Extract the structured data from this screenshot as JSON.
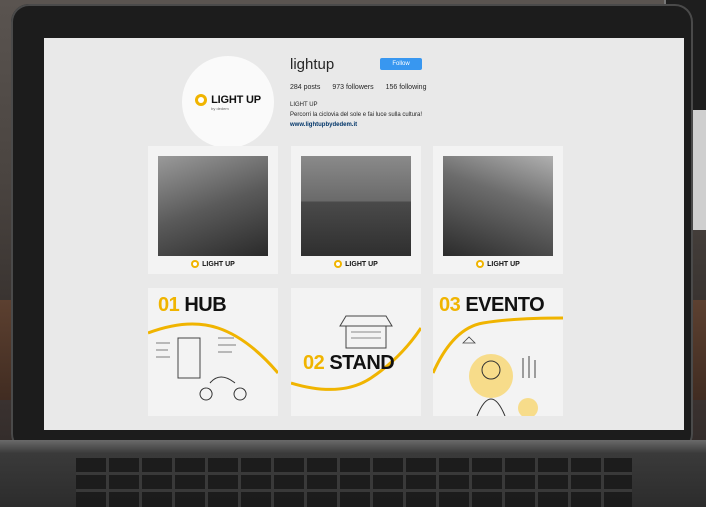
{
  "profile": {
    "username": "lightup",
    "follow_label": "Follow",
    "posts": "284 posts",
    "followers": "973 followers",
    "following": "156 following",
    "bio_name": "LIGHT UP",
    "bio_text": "Percorri la ciclovia del sole e fai luce sulla cultura!",
    "bio_link": "www.lightupbydedem.it",
    "avatar_logo": "LIGHT UP",
    "avatar_sub": "by dedem"
  },
  "posts": [
    {
      "caption_logo": "LIGHT UP"
    },
    {
      "caption_logo": "LIGHT UP"
    },
    {
      "caption_logo": "LIGHT UP"
    },
    {
      "num": "01",
      "title": "HUB"
    },
    {
      "num": "02",
      "title": "STAND"
    },
    {
      "num": "03",
      "title": "EVENTO"
    }
  ],
  "colors": {
    "accent": "#f0b400",
    "follow": "#3897f0",
    "link": "#003569"
  }
}
